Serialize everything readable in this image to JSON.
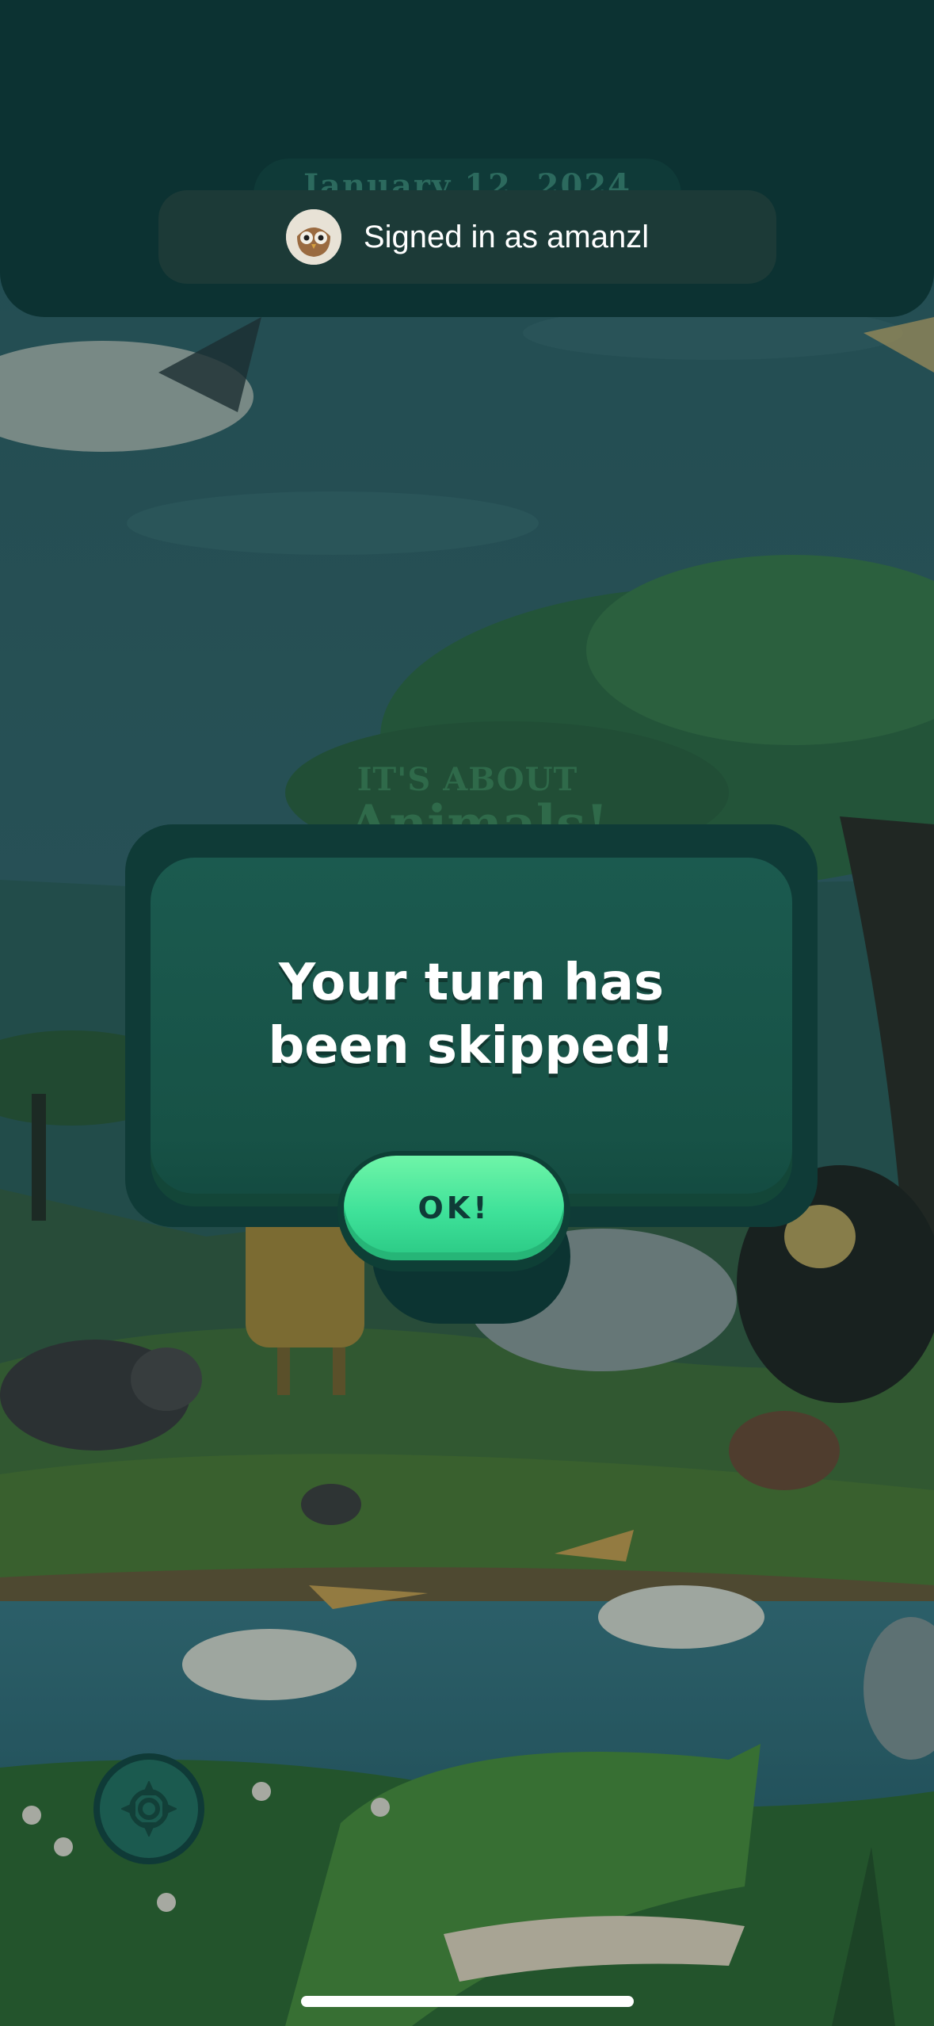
{
  "header": {
    "date_text": "January 12, 2024",
    "toast_text": "Signed in as amanzl",
    "avatar_icon": "owl-avatar-icon"
  },
  "logo": {
    "line1": "IT'S ABOUT",
    "line2": "Animals!"
  },
  "modal": {
    "message_line1": "Your turn has",
    "message_line2": "been skipped!",
    "ok_label": "OK!"
  },
  "controls": {
    "settings_icon": "gear-icon"
  },
  "colors": {
    "panel": "#0c3232",
    "modal": "#175246",
    "ok_button": "#3ee199",
    "text": "#ffffff"
  }
}
